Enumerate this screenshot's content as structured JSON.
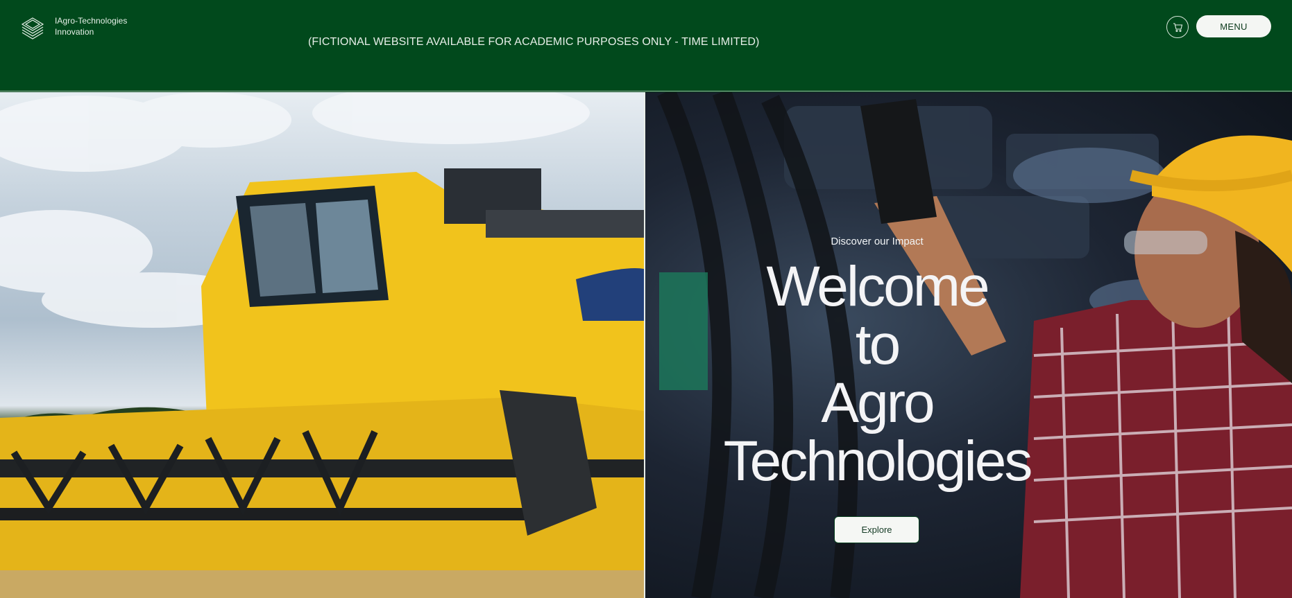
{
  "header": {
    "brand_line1": "IAgro-Technologies",
    "brand_line2": "Innovation",
    "notice": "(FICTIONAL WEBSITE AVAILABLE FOR ACADEMIC PURPOSES ONLY - TIME LIMITED)",
    "cart_icon": "cart-icon",
    "menu_label": "MENU"
  },
  "hero": {
    "eyebrow": "Discover our Impact",
    "title_lines": [
      "Welcome",
      "to",
      "Agro",
      "Technologies"
    ],
    "button_label": "Explore"
  },
  "images": {
    "left": "combine-harvester-photo",
    "right": "worker-with-hardhat-photo"
  },
  "colors": {
    "header_bg": "#01491c",
    "menu_bg": "#f4f6f3",
    "text_light": "#e8efe9"
  }
}
